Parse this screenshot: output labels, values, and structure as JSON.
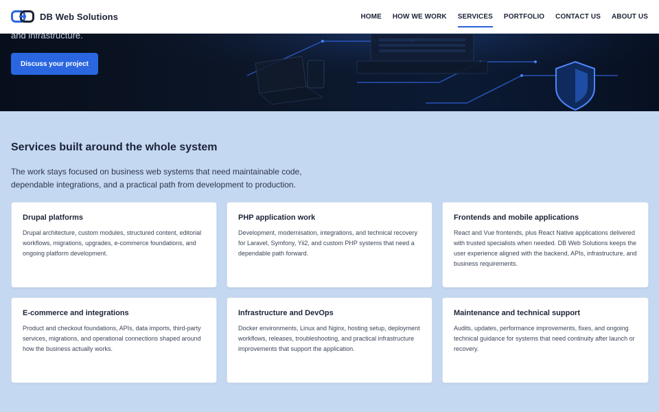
{
  "brand": {
    "name": "DB Web Solutions",
    "logo_icon": "linked-rings-logo-icon"
  },
  "nav": {
    "items": [
      {
        "label": "HOME"
      },
      {
        "label": "HOW WE WORK"
      },
      {
        "label": "SERVICES",
        "active": true
      },
      {
        "label": "PORTFOLIO"
      },
      {
        "label": "CONTACT US"
      },
      {
        "label": "ABOUT US"
      }
    ]
  },
  "hero": {
    "text_fragment": "and infrastructure.",
    "cta_label": "Discuss your project",
    "decorative_icons": [
      "laptop-icon",
      "server-rack-icon",
      "shield-icon",
      "circuit-lines"
    ]
  },
  "section": {
    "title": "Services built around the whole system",
    "intro": "The work stays focused on business web systems that need maintainable code, dependable integrations, and a practical path from development to production.",
    "cards": [
      {
        "title": "Drupal platforms",
        "body": "Drupal architecture, custom modules, structured content, editorial workflows, migrations, upgrades, e-commerce foundations, and ongoing platform development."
      },
      {
        "title": "PHP application work",
        "body": "Development, modernisation, integrations, and technical recovery for Laravel, Symfony, Yii2, and custom PHP systems that need a dependable path forward."
      },
      {
        "title": "Frontends and mobile applications",
        "body": "React and Vue frontends, plus React Native applications delivered with trusted specialists when needed. DB Web Solutions keeps the user experience aligned with the backend, APIs, infrastructure, and business requirements."
      },
      {
        "title": "E-commerce and integrations",
        "body": "Product and checkout foundations, APIs, data imports, third-party services, migrations, and operational connections shaped around how the business actually works."
      },
      {
        "title": "Infrastructure and DevOps",
        "body": "Docker environments, Linux and Nginx, hosting setup, deployment workflows, releases, troubleshooting, and practical infrastructure improvements that support the application."
      },
      {
        "title": "Maintenance and technical support",
        "body": "Audits, updates, performance improvements, fixes, and ongoing technical guidance for systems that need continuity after launch or recovery."
      }
    ]
  },
  "colors": {
    "accent": "#2a66e0",
    "section_background": "#c5d8f2",
    "hero_background": "#0c1628",
    "text_dark": "#1b2336"
  }
}
